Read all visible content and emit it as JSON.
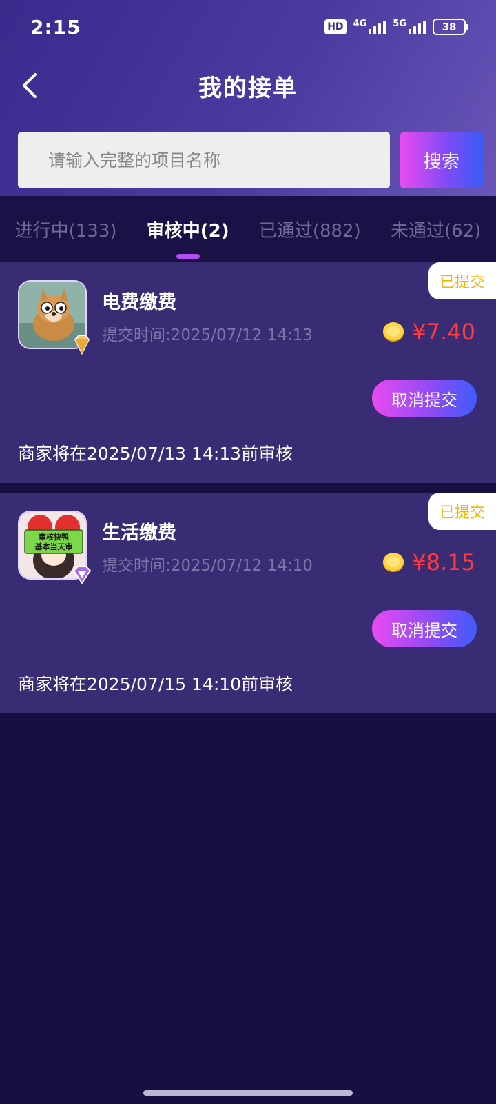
{
  "status_bar": {
    "time": "2:15",
    "hd": "HD",
    "net1": "4G",
    "net2": "5G",
    "battery": "38"
  },
  "nav": {
    "title": "我的接单",
    "back_icon": "chevron-left-icon"
  },
  "search": {
    "placeholder": "请输入完整的项目名称",
    "value": "",
    "button_label": "搜索"
  },
  "tabs": [
    {
      "label": "进行中(133)",
      "active": false
    },
    {
      "label": "审核中(2)",
      "active": true
    },
    {
      "label": "已通过(882)",
      "active": false
    },
    {
      "label": "未通过(62)",
      "active": false
    }
  ],
  "orders": [
    {
      "status": "已提交",
      "title": "电费缴费",
      "submit_time": "提交时间:2025/07/12 14:13",
      "price": "¥7.40",
      "cancel_label": "取消提交",
      "note": "商家将在2025/07/13 14:13前审核",
      "avatar_icon": "dog-avatar-icon",
      "badge_icon": "gold-diamond-badge-icon"
    },
    {
      "status": "已提交",
      "title": "生活缴费",
      "submit_time": "提交时间:2025/07/12 14:10",
      "price": "¥8.15",
      "cancel_label": "取消提交",
      "note": "商家将在2025/07/15 14:10前审核",
      "avatar_icon": "cartoon-avatar-icon",
      "avatar_text": "审核快鸭 基本当天审",
      "badge_icon": "purple-diamond-badge-icon"
    }
  ],
  "colors": {
    "header_start": "#3a2a8c",
    "background": "#160f42",
    "card": "#3a2c74",
    "price": "#ff3b3b",
    "status_text": "#f3b500",
    "accent_tab": "#b44cf5"
  }
}
